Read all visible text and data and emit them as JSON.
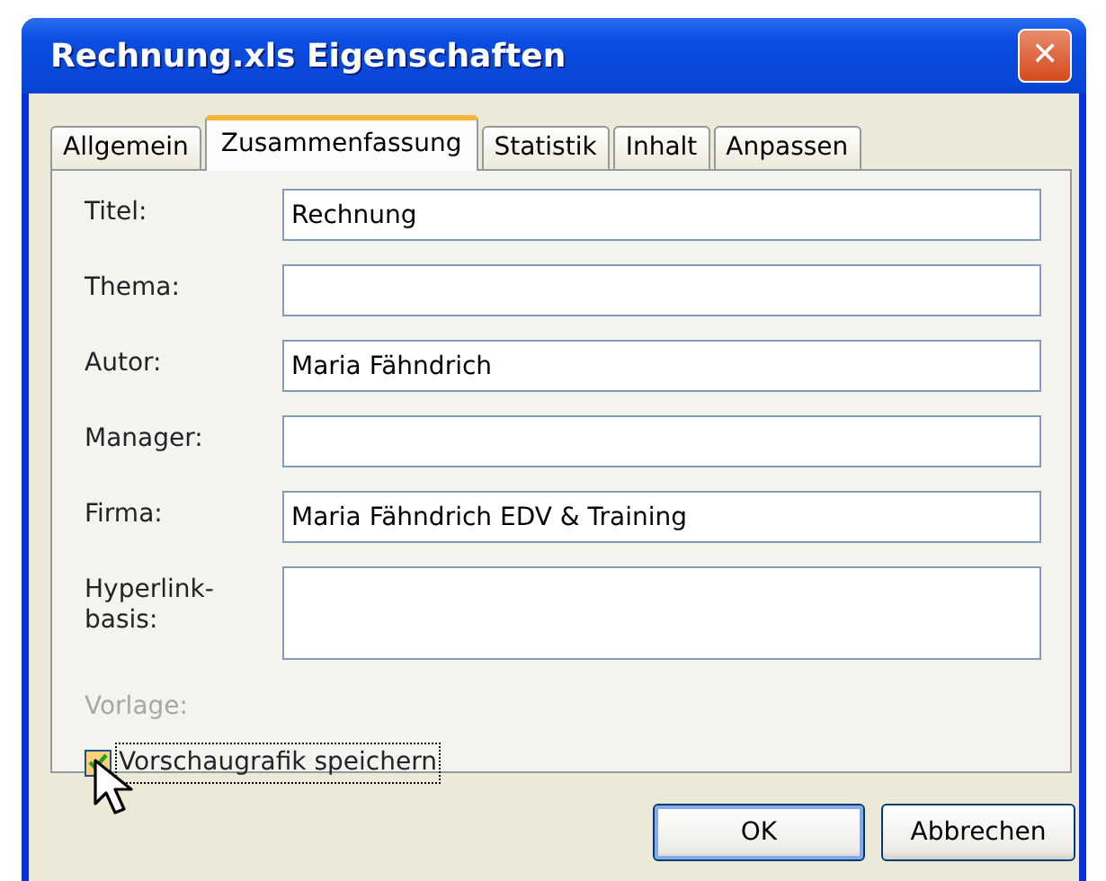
{
  "window": {
    "title": "Rechnung.xls Eigenschaften",
    "close_button": "✕"
  },
  "tabs": [
    {
      "label": "Allgemein",
      "selected": false
    },
    {
      "label": "Zusammenfassung",
      "selected": true
    },
    {
      "label": "Statistik",
      "selected": false
    },
    {
      "label": "Inhalt",
      "selected": false
    },
    {
      "label": "Anpassen",
      "selected": false
    }
  ],
  "fields": [
    {
      "label": "Titel:",
      "value": "Rechnung",
      "kind": "line"
    },
    {
      "label": "Thema:",
      "kind": "line"
    },
    {
      "label": "Autor:",
      "value": "Maria Fähndrich",
      "kind": "line"
    },
    {
      "label": "Manager:",
      "kind": "line"
    },
    {
      "label": "Firma:",
      "value": "Maria Fähndrich EDV & Training",
      "kind": "line"
    },
    {
      "label": "Hyperlink-basis:",
      "kind": "tall"
    },
    {
      "label": "Vorlage:",
      "kind": "readonly"
    }
  ],
  "checkbox": {
    "label": "Vorschaugrafik speichern",
    "checked": true
  },
  "buttons": [
    {
      "label": "OK",
      "default": true
    },
    {
      "label": "Abbrechen",
      "default": false
    }
  ]
}
